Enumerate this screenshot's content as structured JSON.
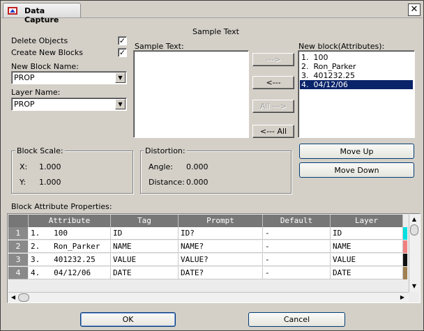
{
  "window": {
    "title": "Data Capture",
    "close": "✕"
  },
  "checks": {
    "delete_objects": {
      "label": "Delete Objects",
      "checked": true
    },
    "create_blocks": {
      "label": "Create New Blocks",
      "checked": true
    }
  },
  "new_block_name": {
    "label": "New Block Name:",
    "value": "PROP"
  },
  "layer_name": {
    "label": "Layer Name:",
    "value": "PROP"
  },
  "sample": {
    "heading": "Sample Text",
    "label": "Sample Text:"
  },
  "transfer": {
    "add": "--->",
    "remove": "<---",
    "add_all": "All --->",
    "remove_all": "<--- All"
  },
  "new_block": {
    "label": "New block(Attributes):",
    "items": [
      "1.  100",
      "2.  Ron_Parker",
      "3.  401232.25",
      "4.  04/12/06"
    ],
    "selected_index": 3
  },
  "block_scale": {
    "title": "Block Scale:",
    "x_label": "X:",
    "x_value": "1.000",
    "y_label": "Y:",
    "y_value": "1.000"
  },
  "distortion": {
    "title": "Distortion:",
    "angle_label": "Angle:",
    "angle_value": "0.000",
    "distance_label": "Distance:",
    "distance_value": "0.000"
  },
  "move": {
    "up": "Move Up",
    "down": "Move Down"
  },
  "grid": {
    "label": "Block Attribute Properties:",
    "columns": [
      "Attribute",
      "Tag",
      "Prompt",
      "Default",
      "Layer"
    ],
    "rows": [
      {
        "n": "1",
        "cells": [
          "1.   100",
          "ID",
          "ID?",
          "-",
          "ID"
        ],
        "color": "#00e0e0"
      },
      {
        "n": "2",
        "cells": [
          "2.   Ron_Parker",
          "NAME",
          "NAME?",
          "-",
          "NAME"
        ],
        "color": "#f08080"
      },
      {
        "n": "3",
        "cells": [
          "3.   401232.25",
          "VALUE",
          "VALUE?",
          "-",
          "VALUE"
        ],
        "color": "#101010"
      },
      {
        "n": "4",
        "cells": [
          "4.   04/12/06",
          "DATE",
          "DATE?",
          "-",
          "DATE"
        ],
        "color": "#a08050"
      }
    ]
  },
  "footer": {
    "ok": "OK",
    "cancel": "Cancel"
  }
}
